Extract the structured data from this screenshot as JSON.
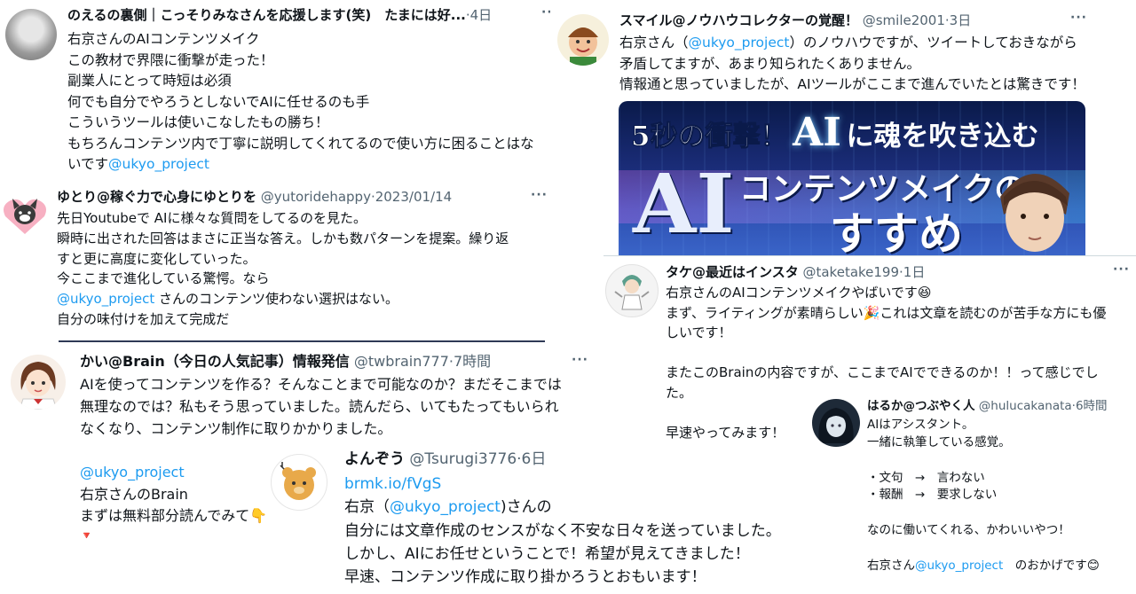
{
  "tweets": {
    "t1": {
      "name": "のえるの裏側｜こっそりみなさんを応援します(笑)　たまには好...",
      "meta": "·4日",
      "lines": [
        "右京さんのAIコンテンツメイク",
        "この教材で界隈に衝撃が走った！",
        "副業人にとって時短は必須",
        "何でも自分でやろうとしないでAIに任せるのも手",
        "こういうツールは使いこなしたもの勝ち！",
        "もちろんコンテンツ内で丁寧に説明してくれてるので使い方に困ることはな"
      ],
      "last_line_text": "いです",
      "mention": "@ukyo_project"
    },
    "t2": {
      "name": "スマイル@ノウハウコレクターの覚醒！",
      "handle": "@smile2001",
      "meta": "·3日",
      "line1_pre": "右京さん（",
      "mention": "@ukyo_project",
      "line1_post": "）のノウハウですが、ツイートしておきながら",
      "line2": "矛盾してますが、あまり知られたくありません。",
      "line3": "情報通と思っていましたが、AIツールがここまで進んでいたとは驚きです！",
      "banner": {
        "line1_a": "5秒の衝撃！",
        "line1_b": "AI",
        "line1_c": "に魂を吹き込む",
        "big": "AI",
        "line2": "コンテンツメイクの",
        "line3": "すすめ"
      }
    },
    "t3": {
      "name": "ゆとり@稼ぐ力で心身にゆとりを",
      "handle": "@yutoridehappy",
      "meta": "·2023/01/14",
      "lines": [
        "先日Youtubeで AIに様々な質問をしてるのを見た。",
        "瞬時に出された回答はまさに正当な答え。しかも数パターンを提案。繰り返",
        "すと更に高度に変化していった。",
        "今ここまで進化している驚愕。なら"
      ],
      "mention": "@ukyo_project",
      "mention_post": " さんのコンテンツ使わない選択はない。",
      "last": "自分の味付けを加えて完成だ"
    },
    "t4": {
      "name": "タケ@最近はインスタ",
      "handle": "@taketake199",
      "meta": "·1日",
      "line1": "右京さんのAIコンテンツメイクやばいです😆",
      "line2": "まず、ライティングが素晴らしい🎉これは文章を読むのが苦手な方にも優",
      "line3": "しいです！",
      "line4": "またこのBrainの内容ですが、ここまでAIでできるのか！！って感じでし",
      "line5": "た。",
      "line6": "早速やってみます！"
    },
    "t5": {
      "name": "かい@Brain（今日の人気記事）情報発信",
      "handle": "@twbrain777",
      "meta": "·7時間",
      "lines": [
        "AIを使ってコンテンツを作る？そんなことまで可能なのか？まだそこまでは",
        "無理なのでは？私もそう思っていました。読んだら、いてもたってもいられ",
        "なくなり、コンテンツ制作に取りかかりました。"
      ],
      "mention": "@ukyo_project",
      "line5": "右京さんのBrain",
      "line6": "まずは無料部分読んでみて👇",
      "line7": "🔻"
    },
    "t6": {
      "name": "よんぞう",
      "handle": "@Tsurugi3776",
      "meta": "·6日",
      "link": "brmk.io/fVgS",
      "line2_pre": "右京（",
      "mention": "@ukyo_project",
      "line2_post": ")さんの",
      "line3": "自分には文章作成のセンスがなく不安な日々を送っていました。",
      "line4": "しかし、AIにお任せということで！希望が見えてきました！",
      "line5": "早速、コンテンツ作成に取り掛かろうとおもいます！"
    },
    "t7": {
      "name": "はるか@つぶやく人",
      "handle": "@hulucakanata",
      "meta": "·6時間",
      "line1": "AIはアシスタント。",
      "line2": "一緒に執筆している感覚。",
      "line3": "・文句　→　言わない",
      "line4": "・報酬　→　要求しない",
      "line5": "なのに働いてくれる、かわいいやつ！",
      "line6_pre": "右京さん",
      "mention": "@ukyo_project",
      "line6_post": "　のおかげです😊"
    }
  },
  "more_glyph": "···",
  "colors": {
    "link": "#1d9bf0",
    "meta": "#536471",
    "text": "#0f1419",
    "divider": "#cfd9de"
  }
}
